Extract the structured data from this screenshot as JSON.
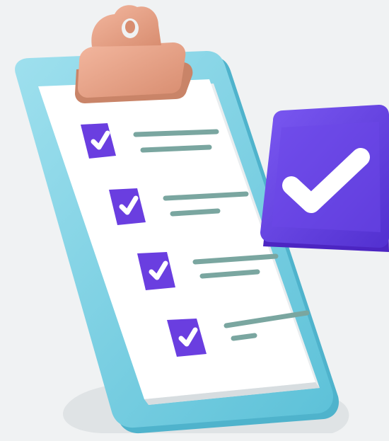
{
  "illustration": {
    "subject": "clipboard-checklist",
    "checklist_item_count": 4,
    "all_items_checked": true,
    "colors": {
      "background": "#f0f2f3",
      "clipboard_board": "#7fd3e6",
      "clipboard_board_shadow": "#4fb3cc",
      "paper": "#ffffff",
      "clip": "#e7a287",
      "clip_shadow": "#c98468",
      "checkbox": "#6a3ee0",
      "checkmark": "#ffffff",
      "text_lines": "#7aa6a0",
      "big_badge": "#6c47e8",
      "big_badge_dark": "#4c25c2"
    },
    "icons": {
      "checkbox": "checkbox-checked-icon",
      "badge": "big-check-badge-icon",
      "clip": "clipboard-clip-icon"
    }
  }
}
